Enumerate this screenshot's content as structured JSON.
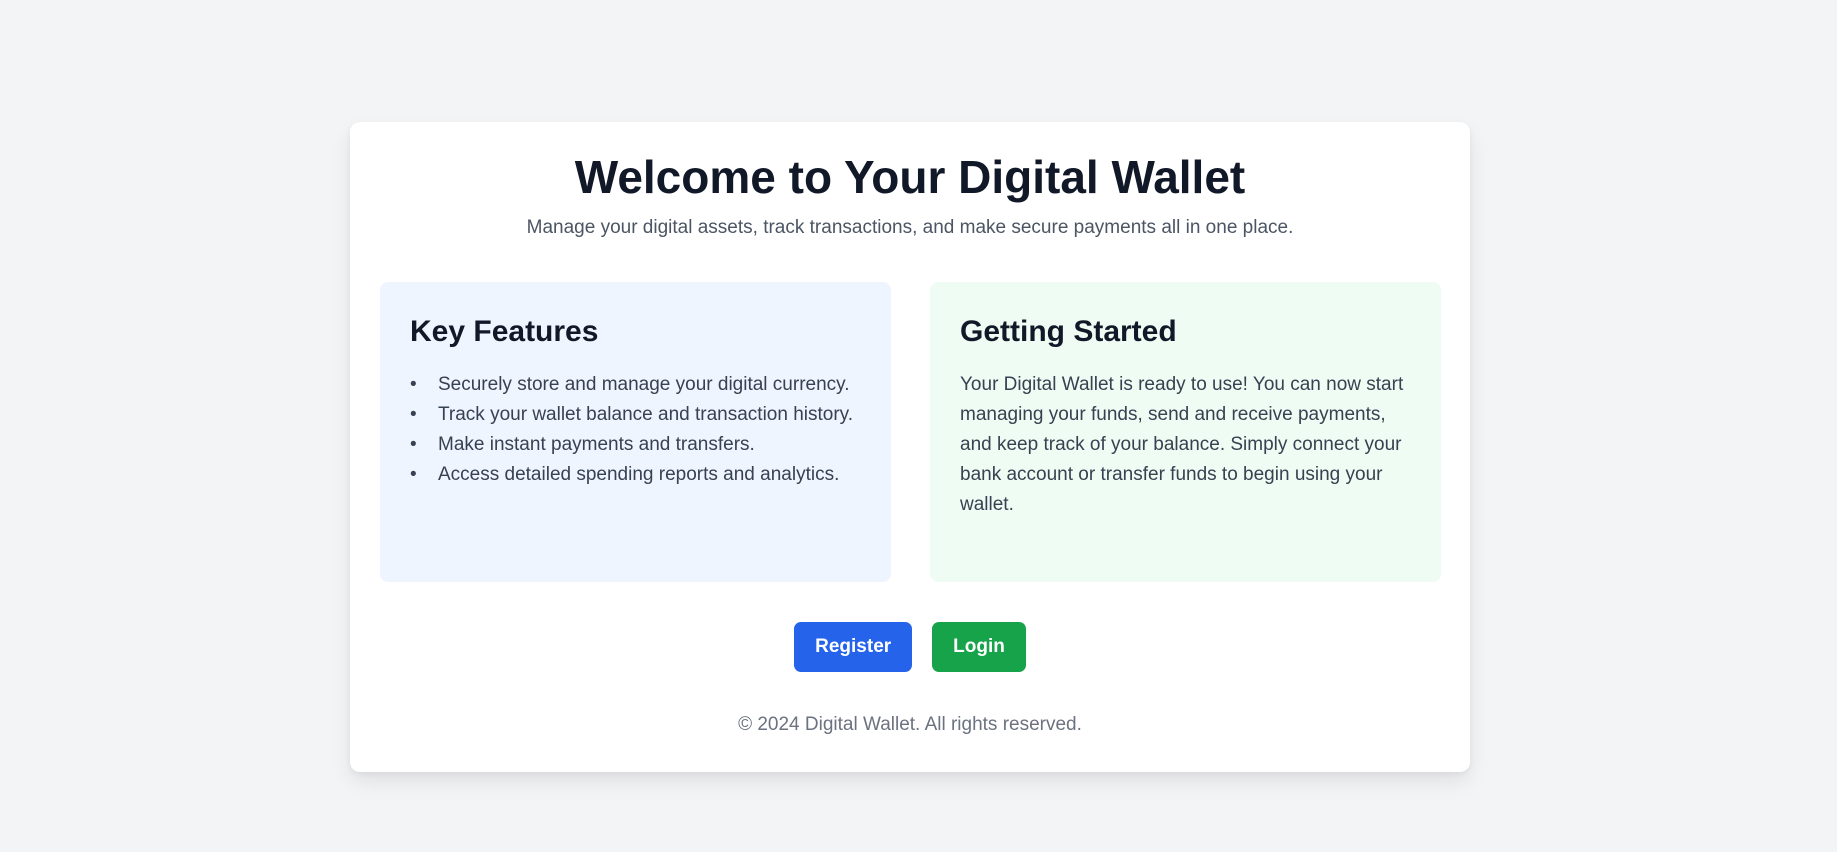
{
  "header": {
    "title": "Welcome to Your Digital Wallet",
    "subtitle": "Manage your digital assets, track transactions, and make secure payments all in one place."
  },
  "features": {
    "heading": "Key Features",
    "items": [
      "Securely store and manage your digital currency.",
      "Track your wallet balance and transaction history.",
      "Make instant payments and transfers.",
      "Access detailed spending reports and analytics."
    ]
  },
  "getting_started": {
    "heading": "Getting Started",
    "text": "Your Digital Wallet is ready to use! You can now start managing your funds, send and receive payments, and keep track of your balance. Simply connect your bank account or transfer funds to begin using your wallet."
  },
  "actions": {
    "register_label": "Register",
    "login_label": "Login"
  },
  "footer": {
    "text": "© 2024 Digital Wallet. All rights reserved."
  },
  "colors": {
    "register": "#2563eb",
    "login": "#16a34a",
    "features_bg": "#eef5ff",
    "started_bg": "#effcf3"
  }
}
